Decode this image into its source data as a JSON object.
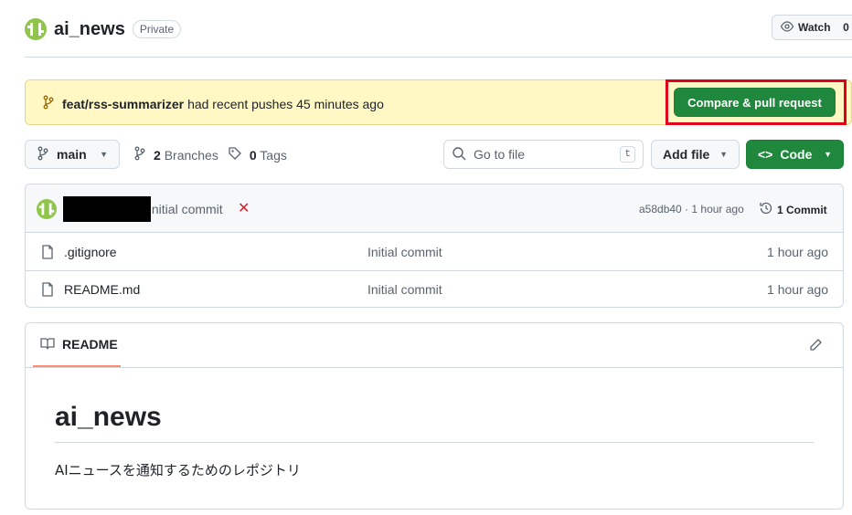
{
  "repo": {
    "name": "ai_news",
    "visibility": "Private",
    "watch_label": "Watch",
    "watch_count": "0"
  },
  "banner": {
    "branch": "feat/rss-summarizer",
    "message": "had recent pushes 45 minutes ago",
    "compare_label": "Compare & pull request"
  },
  "toolbar": {
    "branch": "main",
    "branches_count": "2",
    "branches_label": "Branches",
    "tags_count": "0",
    "tags_label": "Tags",
    "search_placeholder": "Go to file",
    "search_shortcut": "t",
    "add_file_label": "Add file",
    "code_label": "Code"
  },
  "latest_commit": {
    "message": "Initial commit",
    "status": "✕",
    "meta": "a58db40 · 1 hour ago",
    "commits_label": "1 Commit"
  },
  "files": [
    {
      "name": ".gitignore",
      "commit": "Initial commit",
      "time": "1 hour ago"
    },
    {
      "name": "README.md",
      "commit": "Initial commit",
      "time": "1 hour ago"
    }
  ],
  "readme": {
    "tab_label": "README",
    "title": "ai_news",
    "description": "AIニュースを通知するためのレポジトリ"
  },
  "colors": {
    "primary_green": "#1f883d",
    "banner_yellow": "#fff8c5",
    "highlight_red": "#e0001b",
    "avatar_green": "#8fc54a"
  }
}
